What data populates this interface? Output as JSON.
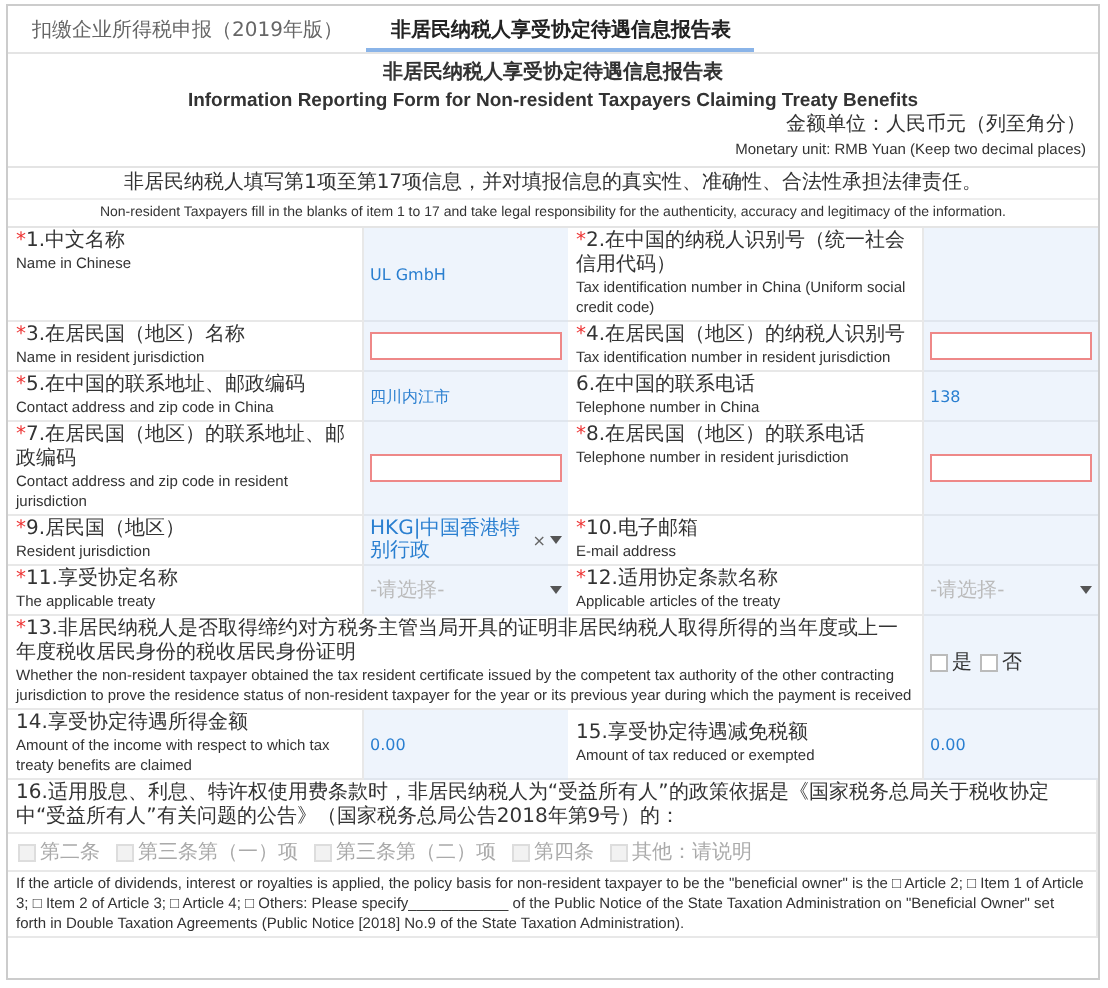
{
  "tabs": [
    {
      "label": "扣缴企业所得税申报（2019年版）",
      "selected": false
    },
    {
      "label": "非居民纳税人享受协定待遇信息报告表",
      "selected": true
    }
  ],
  "form": {
    "title_zh": "非居民纳税人享受协定待遇信息报告表",
    "title_en": "Information Reporting Form for Non-resident Taxpayers Claiming Treaty Benefits",
    "unit_zh": "金额单位：人民币元（列至角分）",
    "unit_en": "Monetary unit: RMB Yuan (Keep two decimal places)",
    "notice_zh": "非居民纳税人填写第1项至第17项信息，并对填报信息的真实性、准确性、合法性承担法律责任。",
    "notice_en": "Non-resident Taxpayers fill in the blanks of item 1 to 17 and take legal responsibility for the authenticity, accuracy and legitimacy of the information.",
    "rows": [
      [
        {
          "mark": "*",
          "label_zh": "1.中文名称",
          "label_en": "Name in Chinese",
          "field": {
            "kind": "text",
            "value": "UL GmbH"
          }
        },
        {
          "mark": "*",
          "label_zh": "2.在中国的纳税人识别号（统一社会信用代码）",
          "label_en": "Tax identification number in China (Uniform social credit code)",
          "field": {
            "kind": "text"
          }
        }
      ],
      [
        {
          "mark": "*",
          "label_zh": "3.在居民国（地区）名称",
          "label_en": "Name in resident jurisdiction",
          "field": {
            "kind": "input",
            "invalid": true
          }
        },
        {
          "mark": "*",
          "label_zh": "4.在居民国（地区）的纳税人识别号",
          "label_en": "Tax identification number in resident jurisdiction",
          "field": {
            "kind": "input",
            "invalid": true
          }
        }
      ],
      [
        {
          "mark": "*",
          "label_zh": "5.在中国的联系地址、邮政编码",
          "label_en": "Contact address and zip code in China",
          "field": {
            "kind": "text",
            "value": "四川内江市"
          }
        },
        {
          "label_zh": "6.在中国的联系电话",
          "label_en": "Telephone number in China",
          "field": {
            "kind": "text",
            "value": "138"
          }
        }
      ],
      [
        {
          "mark": "*",
          "label_zh": "7.在居民国（地区）的联系地址、邮政编码",
          "label_en": "Contact address and zip code in resident jurisdiction",
          "field": {
            "kind": "input",
            "invalid": true
          }
        },
        {
          "mark": "*",
          "label_zh": "8.在居民国（地区）的联系电话",
          "label_en": "Telephone number in resident jurisdiction",
          "field": {
            "kind": "input",
            "invalid": true
          }
        }
      ],
      [
        {
          "mark": "*",
          "label_zh": "9.居民国（地区）",
          "label_en": "Resident jurisdiction",
          "field": {
            "kind": "select",
            "value": "HKG|中国香港特别行政",
            "clear": "×"
          }
        },
        {
          "mark": "*",
          "label_zh": "10.电子邮箱",
          "label_en": "E-mail address",
          "field": {
            "kind": "text"
          }
        }
      ],
      [
        {
          "mark": "*",
          "label_zh": "11.享受协定名称",
          "label_en": "The applicable treaty",
          "field": {
            "kind": "select",
            "placeholder": "-请选择-"
          }
        },
        {
          "mark": "*",
          "label_zh": "12.适用协定条款名称",
          "label_en": "Applicable articles of the treaty",
          "field": {
            "kind": "select",
            "placeholder": "-请选择-"
          }
        }
      ]
    ],
    "item13": {
      "mark": "*",
      "label_zh": "13.非居民纳税人是否取得缔约对方税务主管当局开具的证明非居民纳税人取得所得的当年度或上一年度税收居民身份的税收居民身份证明",
      "label_en": "Whether the non-resident taxpayer obtained the tax resident certificate issued by the competent tax authority of the other contracting jurisdiction to prove the residence status of non-resident taxpayer for the year or its previous year during which the payment is received",
      "options": [
        {
          "label": "是",
          "checked": false
        },
        {
          "label": "否",
          "checked": false
        }
      ]
    },
    "amounts": [
      {
        "label_zh": "14.享受协定待遇所得金额",
        "label_en": "Amount of the income with respect to which tax treaty benefits are claimed",
        "value": "0.00"
      },
      {
        "label_zh": "15.享受协定待遇减免税额",
        "label_en": "Amount of tax reduced or exempted",
        "value": "0.00"
      }
    ],
    "item16": {
      "label_zh": "16.适用股息、利息、特许权使用费条款时，非居民纳税人为“受益所有人”的政策依据是《国家税务总局关于税收协定中“受益所有人”有关问题的公告》（国家税务总局公告2018年第9号）的：",
      "options": [
        {
          "label": "第二条",
          "checked": false,
          "disabled": true
        },
        {
          "label": "第三条第（一）项",
          "checked": false,
          "disabled": true
        },
        {
          "label": "第三条第（二）项",
          "checked": false,
          "disabled": true
        },
        {
          "label": "第四条",
          "checked": false,
          "disabled": true
        },
        {
          "label": "其他：请说明",
          "checked": false,
          "disabled": true
        }
      ],
      "label_en": "If the article of dividends, interest or royalties is applied, the policy basis for non-resident taxpayer to be the \"beneficial owner\" is the □ Article 2; □ Item 1 of Article 3; □ Item 2 of Article 3; □ Article 4; □ Others: Please specify____________ of the Public Notice of the State Taxation Administration on \"Beneficial Owner\" set forth in Double Taxation Agreements (Public Notice [2018] No.9 of the State Taxation Administration)."
    }
  }
}
